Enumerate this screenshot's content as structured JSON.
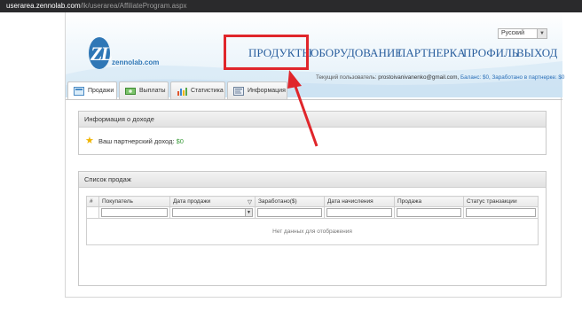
{
  "browser": {
    "url_domain": "userarea.zennolab.com",
    "url_path": "/lk/userarea/AffiliateProgram.aspx"
  },
  "header": {
    "logo_letters": "ZL",
    "logo_text": "zennolab.com",
    "language": "Русский",
    "nav": [
      "ПРОДУКТЫ",
      "ОБОРУДОВАНИЕ",
      "ПАРТНЕРКА",
      "ПРОФИЛЬ",
      "ВЫХОД"
    ],
    "user_label": "Текущий пользователь:",
    "user_email": "prostoivanivanenko@gmail.com,",
    "balance": "Баланс: $0,",
    "earned": "Заработано в партнерке: $0"
  },
  "tabs": [
    "Продажи",
    "Выплаты",
    "Статистика",
    "Информация"
  ],
  "income_panel": {
    "title": "Информация о доходе",
    "label": "Ваш партнерский доход:",
    "value": "$0"
  },
  "sales_panel": {
    "title": "Список продаж",
    "columns": [
      "#",
      "Покупатель",
      "Дата продажи",
      "Заработано($)",
      "Дата начисления",
      "Продажа",
      "Статус транзакции"
    ],
    "empty_text": "Нет данных для отображения"
  },
  "colors": {
    "nav": "#2a5f9e",
    "highlight": "#e0262b",
    "income_value": "#3a9b3a"
  }
}
